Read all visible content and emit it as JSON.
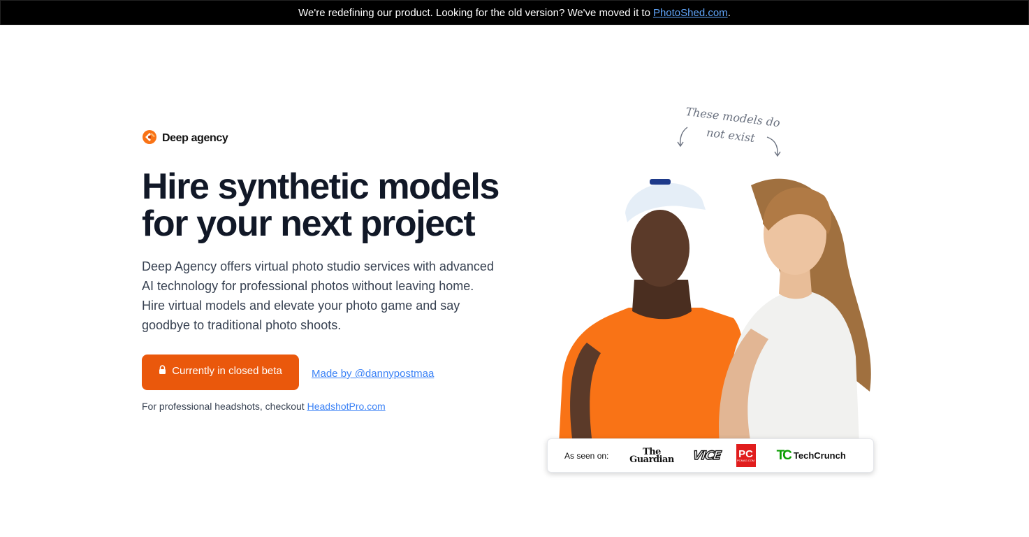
{
  "banner": {
    "text": "We're redefining our product. Looking for the old version? We've moved it to",
    "link": "PhotoShed.com",
    "suffix": "."
  },
  "brand": {
    "name": "Deep agency"
  },
  "hero": {
    "headline": "Hire synthetic models for your next project",
    "description": "Deep Agency offers virtual photo studio services with advanced AI technology for professional photos without leaving home. Hire virtual models and elevate your photo game and say goodbye to traditional photo shoots.",
    "cta_label": "Currently in closed beta",
    "made_by": "Made by @dannypostmaa",
    "headshot_text": "For professional headshots, checkout",
    "headshot_link": "HeadshotPro.com"
  },
  "visual": {
    "note": "These models do not exist"
  },
  "press": {
    "label": "As seen on:",
    "guardian_line1": "The",
    "guardian_line2": "Guardian",
    "vice": "VICE",
    "pc_top": "PC",
    "pc_bottom": "PCMAG.COM",
    "techcrunch_mark": "TC",
    "techcrunch": "TechCrunch"
  },
  "colors": {
    "accent": "#ea580c",
    "link": "#3b82f6",
    "banner_bg": "#000000"
  },
  "icons": [
    "brand-logo-icon",
    "lock-icon",
    "arrow-left-icon",
    "arrow-right-icon"
  ]
}
